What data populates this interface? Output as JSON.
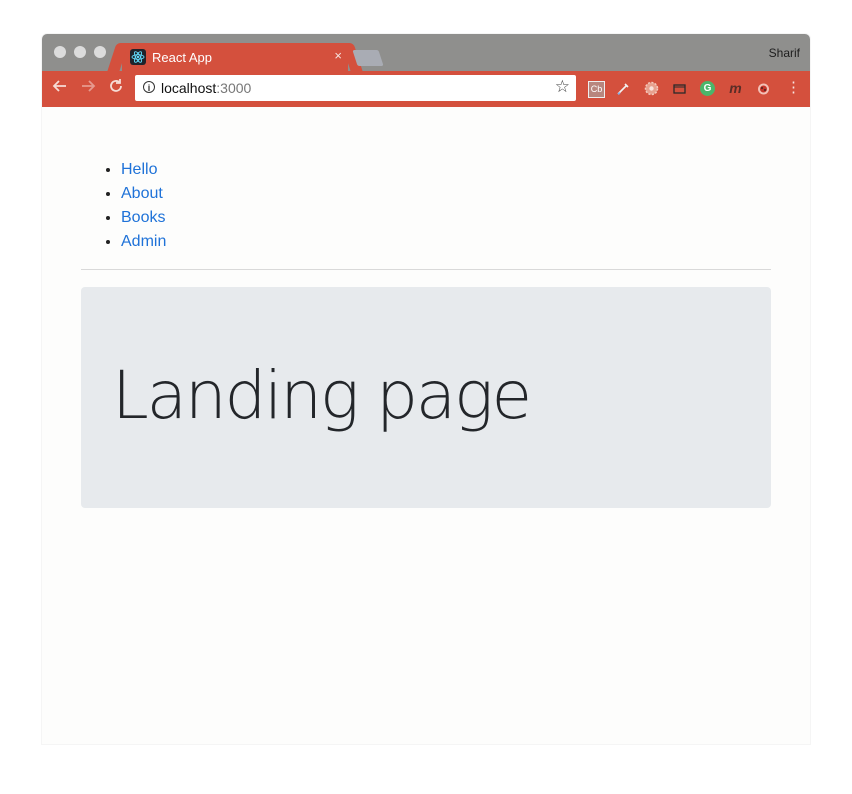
{
  "browser": {
    "tab_title": "React App",
    "tab_close": "×",
    "profile_name": "Sharif",
    "url_host": "localhost",
    "url_port": ":3000",
    "accent_color": "#d4503d",
    "extensions": [
      "Cb",
      "pipette-icon",
      "gear-badge-icon",
      "window-icon",
      "grammarly-icon",
      "m-icon",
      "ladybug-icon"
    ]
  },
  "nav": {
    "items": [
      {
        "label": "Hello"
      },
      {
        "label": "About"
      },
      {
        "label": "Books"
      },
      {
        "label": "Admin"
      }
    ]
  },
  "main": {
    "heading": "Landing page"
  }
}
